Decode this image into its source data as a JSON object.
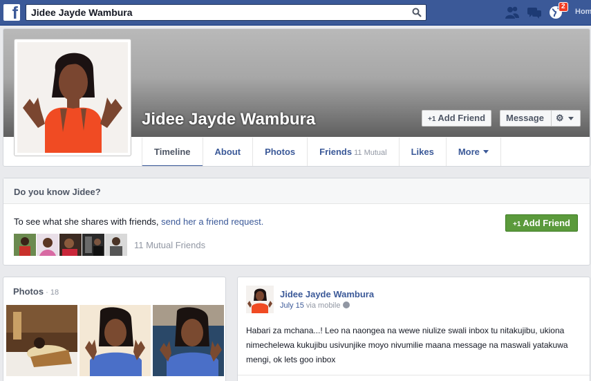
{
  "search": {
    "value": "Jidee Jayde Wambura"
  },
  "topbar": {
    "notification_count": "2",
    "home_label": "Hom"
  },
  "profile": {
    "name": "Jidee Jayde Wambura",
    "add_friend_label": "Add Friend",
    "message_label": "Message",
    "plus_one": "+1"
  },
  "tabs": [
    {
      "label": "Timeline"
    },
    {
      "label": "About"
    },
    {
      "label": "Photos"
    },
    {
      "label": "Friends",
      "sub": "11 Mutual"
    },
    {
      "label": "Likes"
    },
    {
      "label": "More"
    }
  ],
  "know": {
    "heading": "Do you know Jidee?",
    "text": "To see what she shares with friends, ",
    "link": "send her a friend request.",
    "button": "Add Friend",
    "mutual_text": "11 Mutual Friends"
  },
  "photos": {
    "heading": "Photos",
    "separator": " · ",
    "count": "18"
  },
  "post": {
    "author": "Jidee Jayde Wambura",
    "date": "July 15",
    "via": " via mobile",
    "body": "Habari za mchana...! Leo na naongea na wewe niulize swali inbox tu nitakujibu, ukiona nimechelewa kukujibu usivunjike moyo nivumilie maana message na maswali yatakuwa mengi, ok lets goo inbox"
  },
  "colors": {
    "brand": "#3b5998",
    "green_button": "#5b9a3c",
    "badge": "#f03d25"
  }
}
